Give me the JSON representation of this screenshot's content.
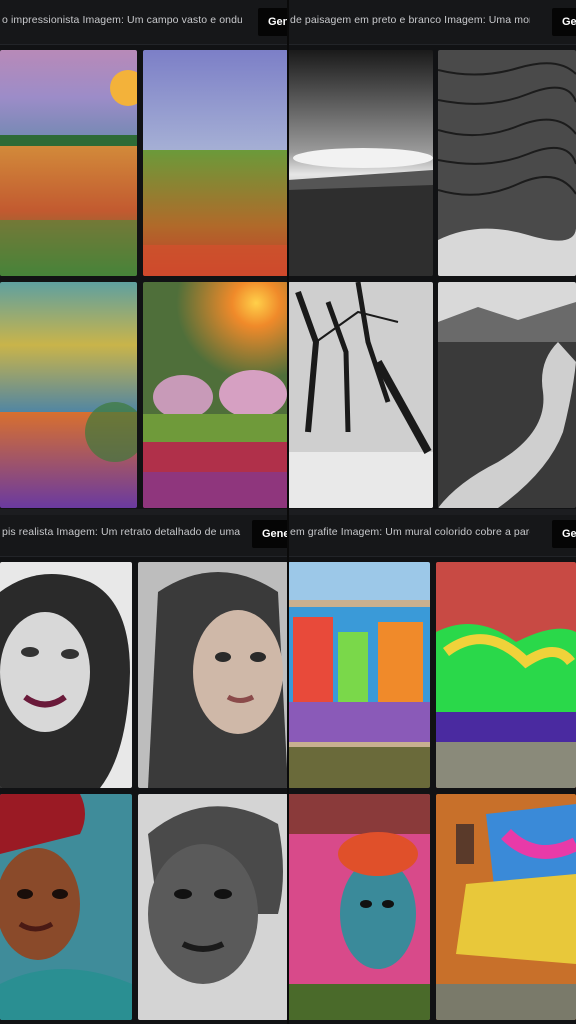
{
  "panels": [
    {
      "prompt": "o impressionista Imagem: Um campo vasto e ondulado cob",
      "generate_label": "Gen"
    },
    {
      "prompt": "de paisagem em preto e branco Imagem: Uma montanha maj",
      "generate_label": "Ge"
    },
    {
      "prompt": "pis realista Imagem: Um retrato detalhado de uma mulher c",
      "generate_label": "Gene"
    },
    {
      "prompt": "em grafite Imagem: Um mural colorido cobre a parede de ur",
      "generate_label": "Ge"
    }
  ],
  "icons": {
    "images": "image-thumbnail-icon"
  }
}
